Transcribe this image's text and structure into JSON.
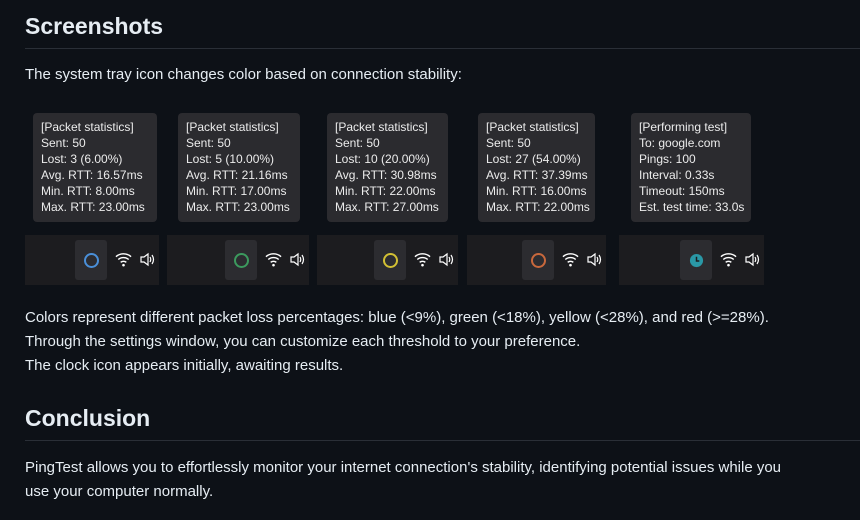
{
  "screenshots_heading": "Screenshots",
  "intro": "The system tray icon changes color based on connection stability:",
  "panels": [
    {
      "lines": [
        "[Packet statistics]",
        "Sent: 50",
        "Lost: 3 (6.00%)",
        "Avg. RTT: 16.57ms",
        "Min. RTT: 8.00ms",
        "Max. RTT: 23.00ms"
      ],
      "icon": "circle-icon",
      "color": "#4a8fd8"
    },
    {
      "lines": [
        "[Packet statistics]",
        "Sent: 50",
        "Lost: 5 (10.00%)",
        "Avg. RTT: 21.16ms",
        "Min. RTT: 17.00ms",
        "Max. RTT: 23.00ms"
      ],
      "icon": "circle-icon",
      "color": "#3c9a5e"
    },
    {
      "lines": [
        "[Packet statistics]",
        "Sent: 50",
        "Lost: 10 (20.00%)",
        "Avg. RTT: 30.98ms",
        "Min. RTT: 22.00ms",
        "Max. RTT: 27.00ms"
      ],
      "icon": "circle-icon",
      "color": "#d2c034"
    },
    {
      "lines": [
        "[Packet statistics]",
        "Sent: 50",
        "Lost: 27 (54.00%)",
        "Avg. RTT: 37.39ms",
        "Min. RTT: 16.00ms",
        "Max. RTT: 22.00ms"
      ],
      "icon": "circle-icon",
      "color": "#c8683c"
    },
    {
      "lines": [
        "[Performing test]",
        "To: google.com",
        "Pings: 100",
        "Interval: 0.33s",
        "Timeout: 150ms",
        "Est. test time: 33.0s"
      ],
      "icon": "clock-icon",
      "color": "#2a98a6"
    }
  ],
  "desc": [
    "Colors represent different packet loss percentages: blue (<9%), green (<18%), yellow (<28%), and red (>=28%).",
    "Through the settings window, you can customize each threshold to your preference.",
    "The clock icon appears initially, awaiting results."
  ],
  "conclusion_heading": "Conclusion",
  "conclusion": [
    "PingTest allows you to effortlessly monitor your internet connection's stability, identifying potential issues while you",
    "use your computer normally."
  ]
}
